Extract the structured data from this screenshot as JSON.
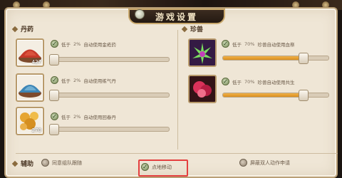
{
  "header": {
    "title": "游戏设置"
  },
  "sections": {
    "pills": {
      "title": "丹药",
      "items": [
        {
          "label": "低于",
          "percent": "2%",
          "action": "自动使用金疮药",
          "count": "427",
          "slider_value": 0.02
        },
        {
          "label": "低于",
          "percent": "2%",
          "action": "自动使用练气丹",
          "count": "",
          "slider_value": 0.02
        },
        {
          "label": "低于",
          "percent": "2%",
          "action": "自动使用回春丹",
          "count": "270",
          "slider_value": 0.02
        }
      ]
    },
    "beasts": {
      "title": "珍兽",
      "items": [
        {
          "label": "低于",
          "percent": "70%",
          "action": "珍兽自动使用血祭",
          "slider_value": 0.7
        },
        {
          "label": "低于",
          "percent": "70%",
          "action": "珍兽自动使用共生",
          "slider_value": 0.7
        }
      ]
    },
    "assist": {
      "title": "辅助",
      "options": [
        {
          "label": "同意组队跟随",
          "checked": false
        },
        {
          "label": "点地移动",
          "checked": true
        },
        {
          "label": "屏蔽双人动作申请",
          "checked": false
        }
      ]
    }
  },
  "colors": {
    "accent": "#d98f1f",
    "highlight": "#e43f3f",
    "check": "#768a58"
  }
}
